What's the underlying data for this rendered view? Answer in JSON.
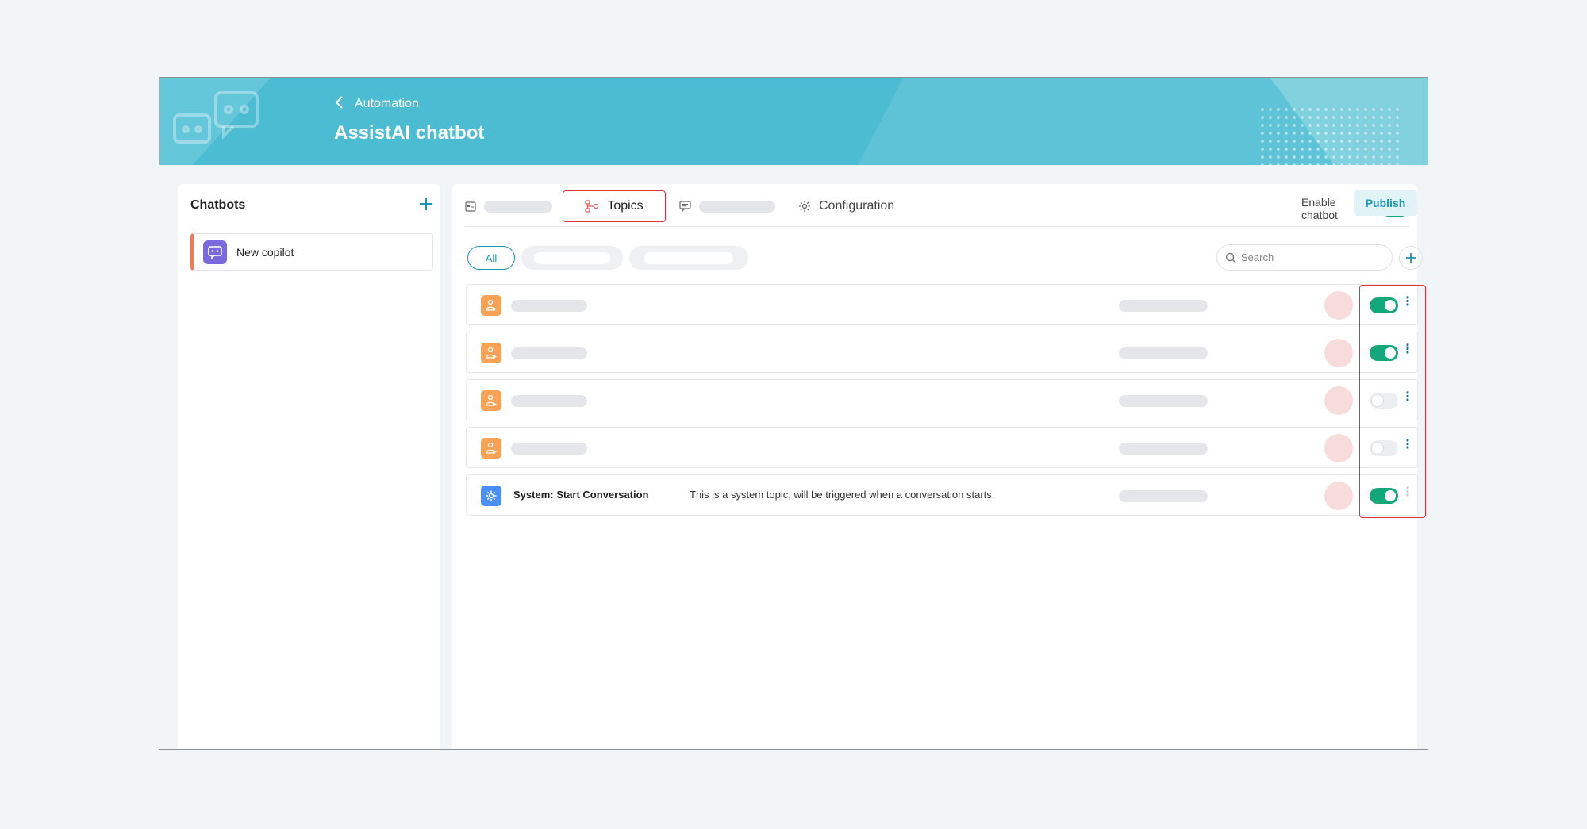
{
  "header": {
    "breadcrumb": "Automation",
    "title": "AssistAI chatbot",
    "back_icon": "chevron-left-icon",
    "background_color": "#4bbcd2"
  },
  "sidebar": {
    "title": "Chatbots",
    "add_icon": "plus-icon",
    "items": [
      {
        "label": "New copilot",
        "icon": "bot-icon",
        "accent": "#f27b55"
      }
    ]
  },
  "tabs": {
    "items": [
      {
        "label": "",
        "icon": "overview-icon"
      },
      {
        "label": "Topics",
        "icon": "topics-flow-icon",
        "selected": true
      },
      {
        "label": "",
        "icon": "chat-icon"
      },
      {
        "label": "Configuration",
        "icon": "gear-icon"
      }
    ],
    "enable_label": "Enable chatbot",
    "enable_on": true,
    "publish_label": "Publish"
  },
  "filters": {
    "items": [
      {
        "label": "All",
        "active": true
      },
      {
        "label": ""
      },
      {
        "label": ""
      }
    ],
    "search_placeholder": "Search"
  },
  "topics": [
    {
      "type": "custom",
      "enabled": true
    },
    {
      "type": "custom",
      "enabled": true
    },
    {
      "type": "custom",
      "enabled": false
    },
    {
      "type": "custom",
      "enabled": false
    },
    {
      "type": "system",
      "name": "System: Start Conversation",
      "description": "This is a system topic, will be triggered when a conversation starts.",
      "enabled": true
    }
  ],
  "colors": {
    "accent": "#1a95b4",
    "toggle_on": "#13a87c",
    "highlight": "#e0313b"
  }
}
